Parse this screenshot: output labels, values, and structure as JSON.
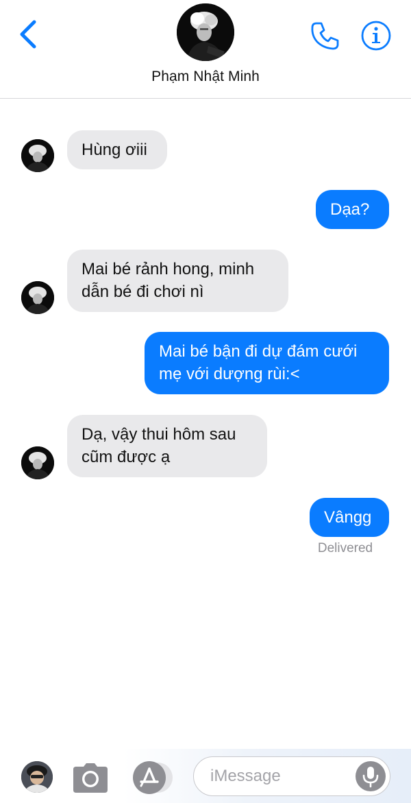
{
  "header": {
    "back_icon": "chevron-left-icon",
    "contact_name": "Phạm Nhật Minh",
    "phone_icon": "phone-icon",
    "info_icon": "info-icon",
    "accent_color": "#0a7cff"
  },
  "messages": [
    {
      "direction": "incoming",
      "lines": [
        "Hùng ơiii"
      ]
    },
    {
      "direction": "outgoing",
      "lines": [
        "Dạa?"
      ]
    },
    {
      "direction": "incoming",
      "lines": [
        "Mai bé rảnh hong, minh",
        "dẫn bé đi chơi nì"
      ]
    },
    {
      "direction": "outgoing",
      "lines": [
        "Mai bé bận đi dự đám cưới",
        "mẹ với dượng rùi:<"
      ]
    },
    {
      "direction": "incoming",
      "lines": [
        "Dạ, vậy thui hôm sau",
        "cũm được ạ"
      ]
    },
    {
      "direction": "outgoing",
      "lines": [
        "Vângg"
      ]
    }
  ],
  "status": {
    "delivered": "Delivered"
  },
  "colors": {
    "incoming_bubble": "#e9e9eb",
    "outgoing_bubble": "#0a7cff"
  },
  "composer": {
    "memoji_icon": "memoji-avatar-icon",
    "camera_icon": "camera-icon",
    "apps_icon": "app-store-icon",
    "placeholder": "iMessage",
    "mic_icon": "microphone-icon"
  }
}
